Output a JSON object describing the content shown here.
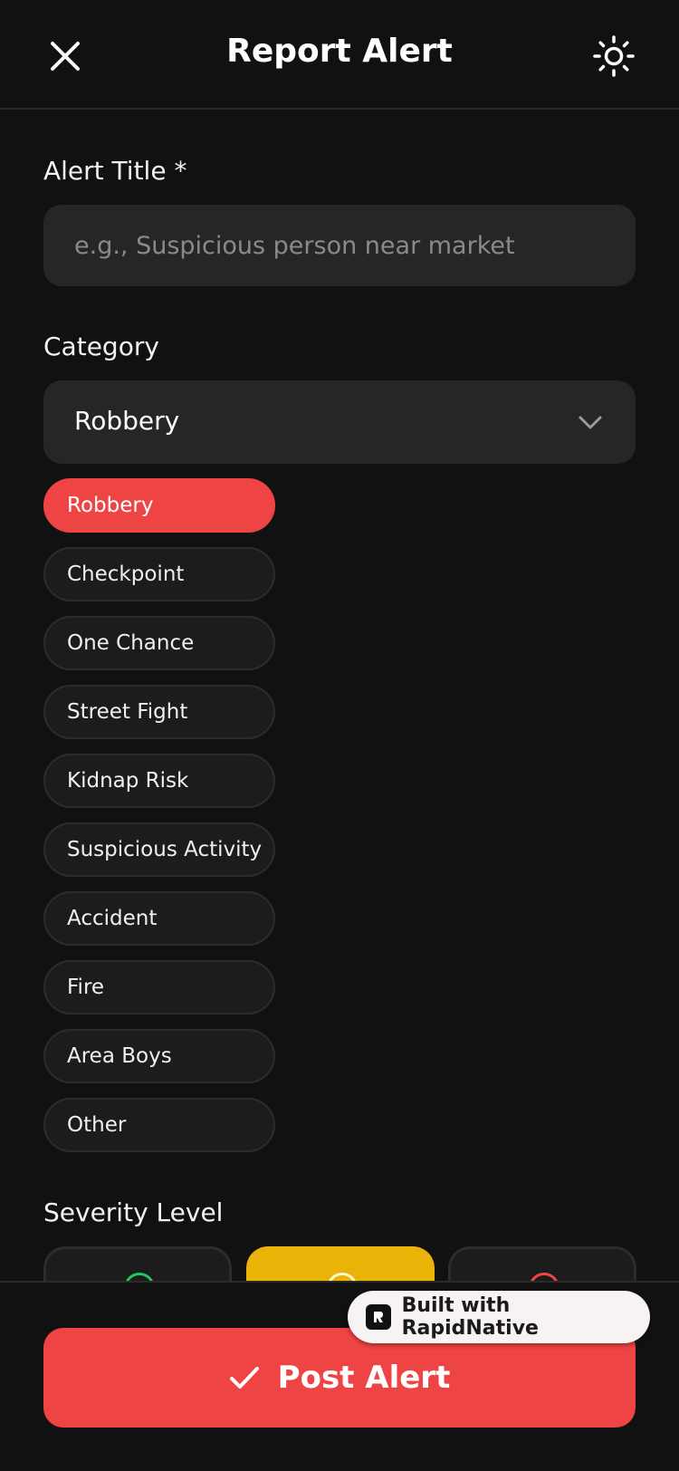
{
  "header": {
    "title": "Report Alert",
    "close_icon": "close-icon",
    "theme_icon": "sun-icon"
  },
  "form": {
    "title_label": "Alert Title *",
    "title_placeholder": "e.g., Suspicious person near market",
    "category_label": "Category",
    "category_selected": "Robbery",
    "categories": [
      "Robbery",
      "Checkpoint",
      "One Chance",
      "Street Fight",
      "Kidnap Risk",
      "Suspicious Activity",
      "Accident",
      "Fire",
      "Area Boys",
      "Other"
    ],
    "severity_label": "Severity Level"
  },
  "footer": {
    "post_label": "Post Alert",
    "badge_label": "Built with RapidNative"
  },
  "colors": {
    "background": "#111111",
    "accent": "#ef4444",
    "severity_low": "#22c55e",
    "severity_medium": "#eab308",
    "severity_high": "#ef4444"
  }
}
